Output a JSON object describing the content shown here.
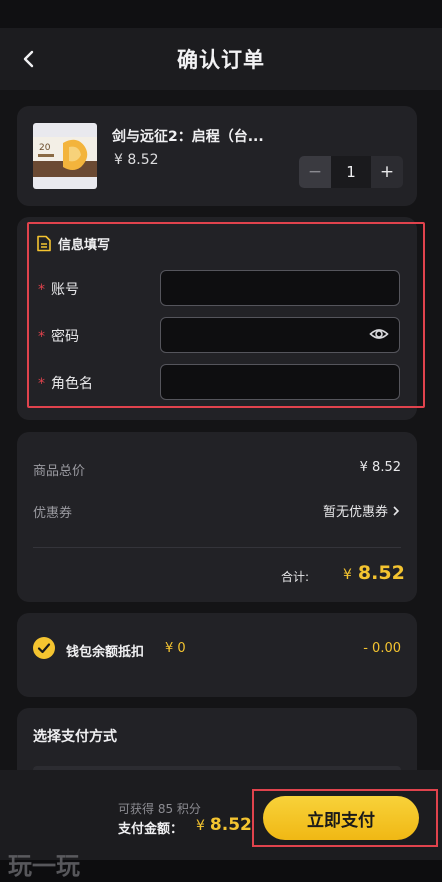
{
  "header": {
    "title": "确认订单"
  },
  "product": {
    "name": "剑与远征2：启程（台...",
    "price": "¥ 8.52",
    "quantity": "1",
    "minus": "−",
    "plus": "+"
  },
  "info": {
    "title": "信息填写",
    "fields": [
      {
        "label": "账号",
        "value": ""
      },
      {
        "label": "密码",
        "value": ""
      },
      {
        "label": "角色名",
        "value": ""
      }
    ],
    "required_mark": "*"
  },
  "summary": {
    "subtotal_label": "商品总价",
    "subtotal_value": "¥ 8.52",
    "coupon_label": "优惠券",
    "coupon_value": "暂无优惠券",
    "total_label": "合计:",
    "total_currency": "¥",
    "total_value": "8.52"
  },
  "wallet": {
    "label": "钱包余额抵扣",
    "amount": "¥ 0",
    "deduct": "- 0.00",
    "checked": true
  },
  "payment": {
    "title": "选择支付方式"
  },
  "footer": {
    "points": "可获得 85 积分",
    "pay_label": "支付金额：",
    "pay_currency": "¥",
    "pay_value": "8.52",
    "pay_button": "立即支付"
  },
  "watermark": "玩一玩",
  "colors": {
    "accent": "#f4c430",
    "highlight": "#e0434d",
    "card": "#222226"
  },
  "icons": [
    "back-icon",
    "document-icon",
    "eye-icon",
    "check-circle-icon",
    "chevron-right-icon"
  ]
}
